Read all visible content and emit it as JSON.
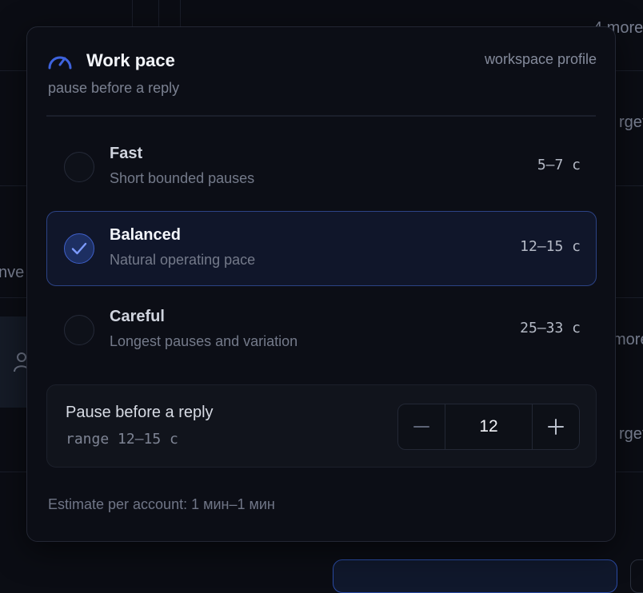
{
  "background": {
    "fragments": [
      "4 more",
      "rget",
      "nve",
      "more",
      "rget"
    ]
  },
  "modal": {
    "title": "Work pace",
    "subtitle": "pause before a reply",
    "profile_label": "workspace profile",
    "options": [
      {
        "name": "Fast",
        "description": "Short bounded pauses",
        "range": "5–7 с",
        "selected": false
      },
      {
        "name": "Balanced",
        "description": "Natural operating pace",
        "range": "12–15 с",
        "selected": true
      },
      {
        "name": "Careful",
        "description": "Longest pauses and variation",
        "range": "25–33 с",
        "selected": false
      }
    ],
    "pause": {
      "label": "Pause before a reply",
      "range": "range 12–15 с",
      "value": "12"
    },
    "estimate": "Estimate per account: 1 мин–1 мин"
  },
  "colors": {
    "accent": "#3e5fc8",
    "background": "#0b0d14",
    "card": "#0c0e16"
  },
  "icons": {
    "title": "speedometer-icon",
    "check": "check-icon",
    "minus": "minus-icon",
    "plus": "plus-icon",
    "background_user": "user-icon"
  }
}
